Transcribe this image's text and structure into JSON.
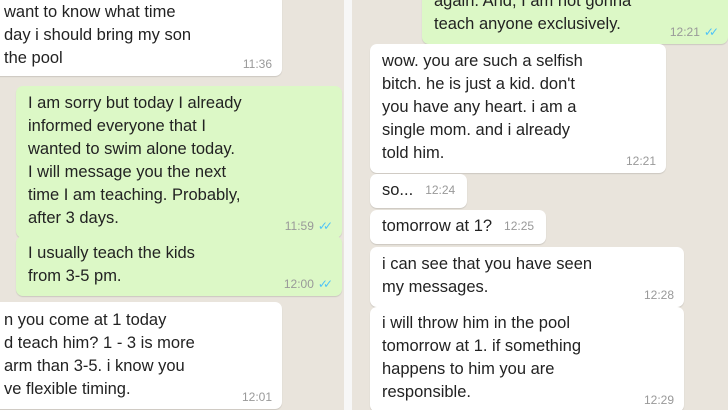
{
  "left_panel": {
    "messages": [
      {
        "direction": "incoming",
        "text": "want to know what time\nday i should bring my son\nthe pool",
        "time": "11:36"
      },
      {
        "direction": "outgoing",
        "text": "I am sorry but today I already\ninformed everyone that I\nwanted to swim alone today.\nI will message you the next\ntime I am teaching. Probably,\nafter 3 days.",
        "time": "11:59",
        "read": "double-check-icon"
      },
      {
        "direction": "outgoing",
        "text": "I usually teach the kids\nfrom 3-5 pm.",
        "time": "12:00",
        "read": "double-check-icon"
      },
      {
        "direction": "incoming",
        "text": "n you come at 1 today\nd teach him? 1 - 3 is more\narm than 3-5. i know you\nve flexible timing.",
        "time": "12:01"
      }
    ]
  },
  "right_panel": {
    "messages": [
      {
        "direction": "outgoing",
        "text": "again. And, I am not gonna\nteach anyone exclusively.",
        "time": "12:21",
        "read": "double-check-icon"
      },
      {
        "direction": "incoming",
        "text": "wow. you are such a selfish\nbitch. he is just a kid. don't\nyou have any heart. i am a\nsingle mom. and i already\ntold him.",
        "time": "12:21"
      },
      {
        "direction": "incoming",
        "text": "so...",
        "time": "12:24"
      },
      {
        "direction": "incoming",
        "text": "tomorrow at 1?",
        "time": "12:25"
      },
      {
        "direction": "incoming",
        "text": "i can see that you have seen\nmy messages.",
        "time": "12:28"
      },
      {
        "direction": "incoming",
        "text": "i will throw him in the pool\ntomorrow at 1. if something\nhappens to him you are\nresponsible.",
        "time": "12:29"
      }
    ]
  },
  "colors": {
    "chat_background": "#e9e4dc",
    "incoming_bubble": "#ffffff",
    "outgoing_bubble": "#dcf8c6",
    "read_receipt": "#4fc3f7"
  }
}
